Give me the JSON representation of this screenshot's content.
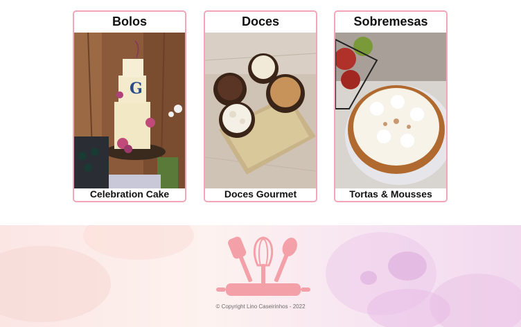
{
  "cards": [
    {
      "title": "Bolos",
      "caption": "Celebration Cake",
      "image_icon": "cake-photo"
    },
    {
      "title": "Doces",
      "caption": "Doces Gourmet",
      "image_icon": "sweets-photo"
    },
    {
      "title": "Sobremesas",
      "caption": "Tortas & Mousses",
      "image_icon": "pie-photo"
    }
  ],
  "footer": {
    "logo_icon": "baking-utensils-logo",
    "copyright": "© Copyright Lino Caseirinhos - 2022"
  },
  "colors": {
    "card_border": "#f4a6b8",
    "logo_pink": "#f4a0a8",
    "footer_bg": "#fbe8ec"
  }
}
